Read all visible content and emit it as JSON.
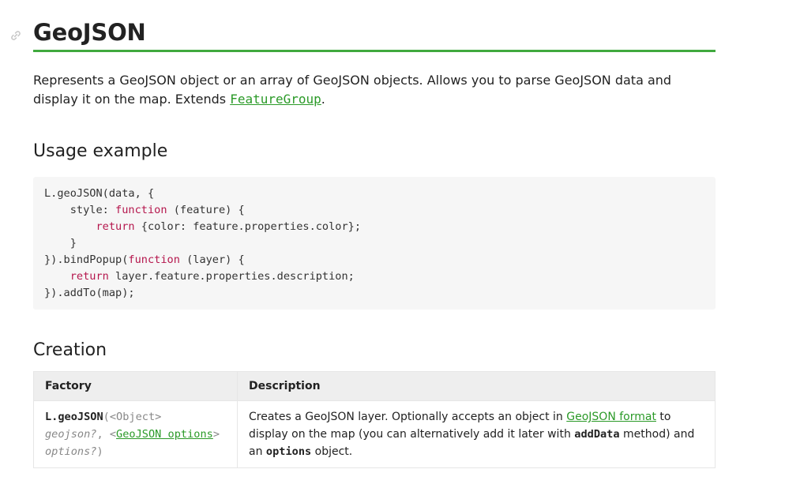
{
  "heading": "GeoJSON",
  "intro": {
    "text_before": "Represents a GeoJSON object or an array of GeoJSON objects. Allows you to parse GeoJSON data and display it on the map. Extends ",
    "link": "FeatureGroup",
    "text_after": "."
  },
  "usage": {
    "title": "Usage example",
    "code": {
      "l1": "L.geoJSON(data, {",
      "l2_pre": "    style: ",
      "l2_kw": "function",
      "l2_post": " (feature) {",
      "l3_pre": "        ",
      "l3_kw": "return",
      "l3_post": " {color: feature.properties.color};",
      "l4": "    }",
      "l5_pre": "}).bindPopup(",
      "l5_kw": "function",
      "l5_post": " (layer) {",
      "l6_pre": "    ",
      "l6_kw": "return",
      "l6_post": " layer.feature.properties.description;",
      "l7": "}).addTo(map);"
    }
  },
  "creation": {
    "title": "Creation",
    "headers": {
      "factory": "Factory",
      "description": "Description"
    },
    "row": {
      "fn": "L.geoJSON",
      "paren_open": "(",
      "type1": "<Object>",
      "param1": "geojson?",
      "sep": ", ",
      "type2_open": "<",
      "type2_link": "GeoJSON options",
      "type2_close": ">",
      "param2": "options?",
      "paren_close": ")",
      "desc_1": "Creates a GeoJSON layer. Optionally accepts an object in ",
      "desc_link": "GeoJSON format",
      "desc_2": " to display on the map (you can alternatively add it later with ",
      "desc_code1": "addData",
      "desc_3": " method) and an ",
      "desc_code2": "options",
      "desc_4": " object."
    }
  },
  "colors": {
    "accent": "#40a93e",
    "link": "#2b9a28",
    "keyword": "#b5174d"
  }
}
